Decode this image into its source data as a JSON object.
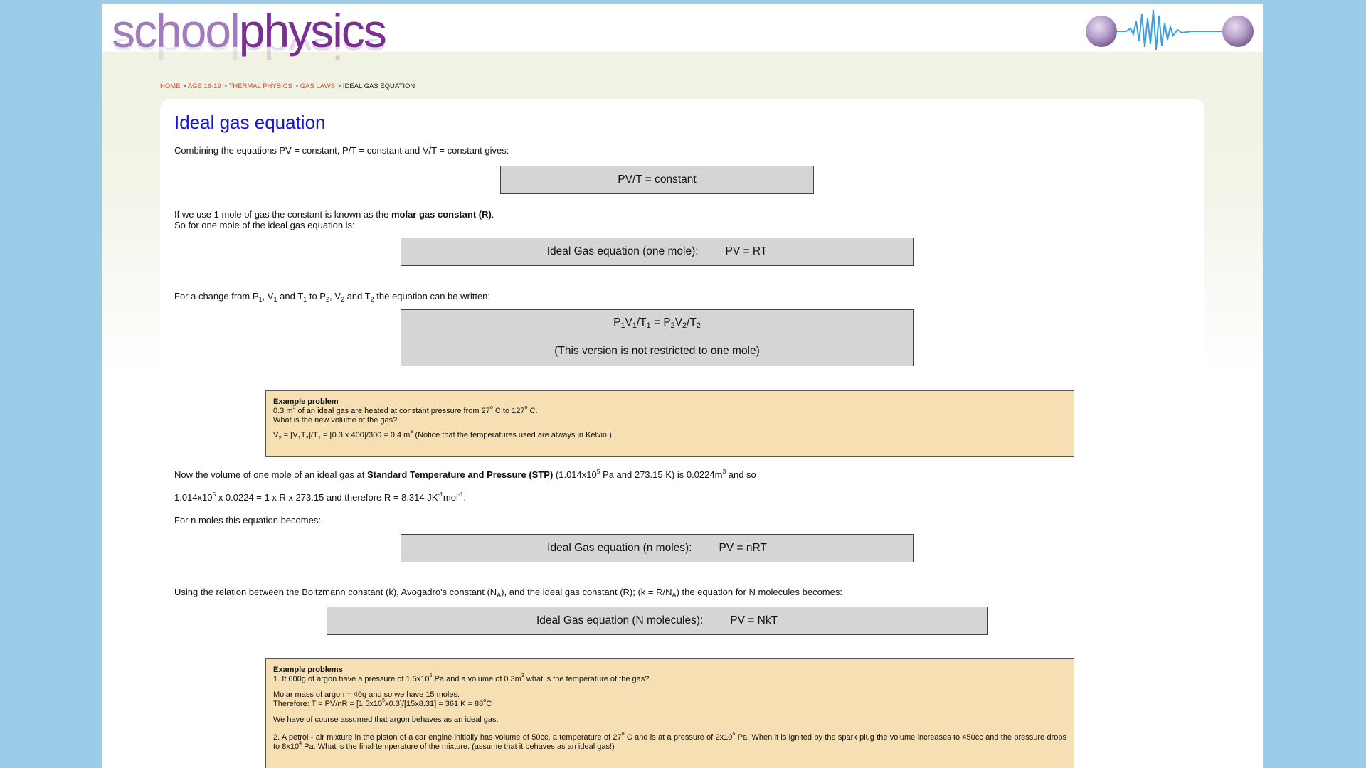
{
  "logo": {
    "part1": "school",
    "part2": "physics"
  },
  "breadcrumb": {
    "home": "HOME",
    "age": "AGE 16-19",
    "topic": "THERMAL PHYSICS",
    "subtopic": "GAS LAWS",
    "current": "IDEAL GAS EQUATION",
    "separator": ">"
  },
  "title": "Ideal gas equation",
  "intro": "Combining the equations PV = constant, P/T = constant and V/T = constant gives:",
  "eq1": "PV/T = constant",
  "molar": {
    "line1_pre": "If we use 1 mole of gas the constant is known as the ",
    "line1_bold": "molar gas constant (R)",
    "line1_post": ".",
    "line2": "So for one mole of the ideal gas equation is:"
  },
  "eq_one_mole": {
    "label": "Ideal Gas equation (one mole):",
    "formula": "PV = RT"
  },
  "change": {
    "t1": "For a change from P",
    "s1": "1",
    "t2": ", V",
    "s2": "1",
    "t3": " and T",
    "s3": "1",
    "t4": " to P",
    "s4": "2",
    "t5": ", V",
    "s5": "2",
    "t6": " and T",
    "s6": "2",
    "t7": " the equation can be written:"
  },
  "eq_change": {
    "p": "P",
    "s1": "1",
    "v": "V",
    "s2": "1",
    "t": "/T",
    "s3": "1",
    "eq": " = P",
    "s4": "2",
    "v2": "V",
    "s5": "2",
    "t2": "/T",
    "s6": "2",
    "note": "(This version is not restricted to one mole)"
  },
  "example1": {
    "heading": "Example problem",
    "l1a": "0.3 m",
    "l1sup": "3",
    "l1b": " of an ideal gas are heated at constant pressure from 27",
    "l1sup2": "o",
    "l1c": " C to 127",
    "l1sup3": "o",
    "l1d": " C.",
    "l2": "What is the new volume of the gas?",
    "l3a": "V",
    "l3s1": "2",
    "l3b": " = [V",
    "l3s2": "1",
    "l3c": "T",
    "l3s3": "2",
    "l3d": "]/T",
    "l3s4": "1",
    "l3e": " = [0.3 x 400]/300 = 0.4 m",
    "l3sup": "3",
    "l3f": " (Notice that the temperatures used are always in Kelvin!)"
  },
  "stp": {
    "a": "Now the volume of one mole of an ideal gas at ",
    "bold": "Standard Temperature and Pressure (STP)",
    "b": " (1.014x10",
    "sup1": "5",
    "c": " Pa and 273.15 K) is 0.0224m",
    "sup2": "3",
    "d": " and so"
  },
  "calc": {
    "a": "1.014x10",
    "sup1": "5",
    "b": " x 0.0224 = 1 x R x 273.15 and therefore R = 8.314 JK",
    "sup2": "-1",
    "c": "mol",
    "sup3": "-1",
    "d": "."
  },
  "nmoles_intro": "For n moles this equation becomes:",
  "eq_n_moles": {
    "label": "Ideal Gas equation (n moles):",
    "formula": "PV = nRT"
  },
  "boltz": {
    "a": "Using the relation between the Boltzmann constant (k), Avogadro's constant (N",
    "s1": "A",
    "b": "), and the ideal gas constant (R); (k = R/N",
    "s2": "A",
    "c": ") the equation for N molecules becomes:"
  },
  "eq_n_molecules": {
    "label": "Ideal Gas equation (N molecules):",
    "formula": "PV = NkT"
  },
  "example2": {
    "heading": "Example problems",
    "q1a": "1. If 600g of argon have a pressure of 1.5x10",
    "q1sup1": "5",
    "q1b": " Pa and a volume of 0.3m",
    "q1sup2": "3",
    "q1c": " what is the temperature of the gas?",
    "m1": "Molar mass of argon = 40g and so we have 15 moles.",
    "m2a": "Therefore: T = PV/nR = [1.5x10",
    "m2sup1": "5",
    "m2b": "x0.3]/[15x8.31] = 361 K = 88",
    "m2sup2": "o",
    "m2c": "C",
    "m3": "We have of course assumed that argon behaves as an ideal gas.",
    "q2a": "2. A petrol - air mixture in the piston of a car engine initially has volume of 50cc, a temperature of 27",
    "q2sup1": "o",
    "q2b": " C and is at a pressure of 2x10",
    "q2sup2": "5",
    "q2c": " Pa. When it is ignited by the spark plug the volume increases to 450cc and the pressure drops to 8x10",
    "q2sup3": "4",
    "q2d": " Pa. What is the final temperature of the mixture. (assume that it behaves as an ideal gas!)"
  },
  "colors": {
    "background": "#9ccbe8",
    "title": "#1515d8",
    "link": "#d2502c",
    "box": "#d5d5d5",
    "example": "#f5dfb3",
    "logo_light": "#a37bbd",
    "logo_dark": "#7b2f93",
    "wave": "#3aa0e0"
  },
  "icons": {
    "header_graphic": "oscillating-wave-between-spheres-icon"
  }
}
